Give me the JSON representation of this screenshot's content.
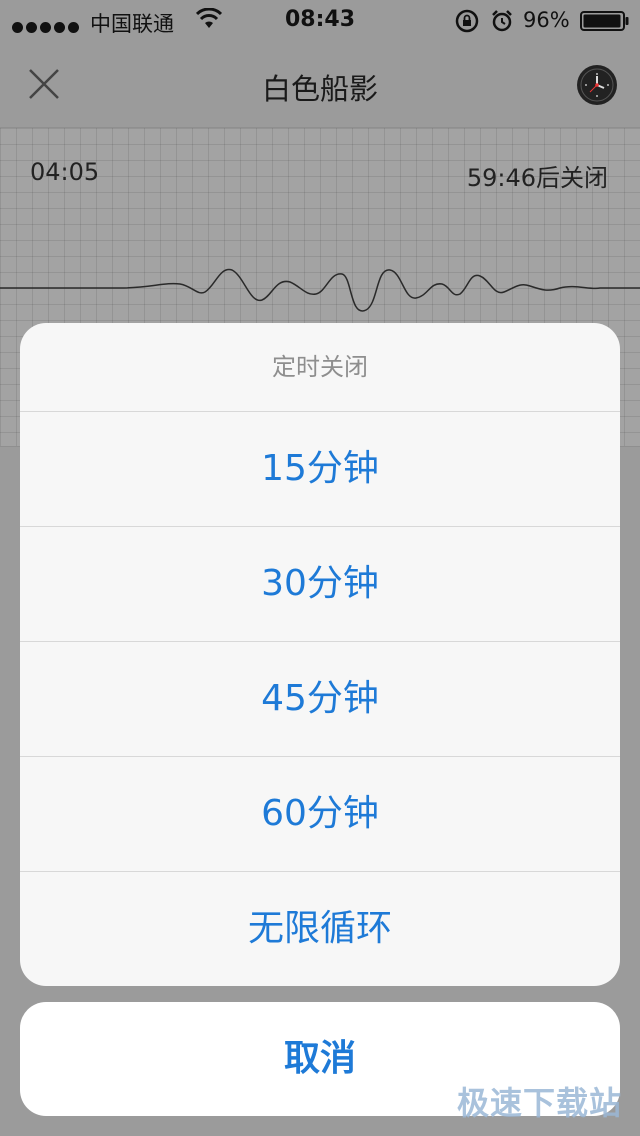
{
  "status_bar": {
    "carrier": "中国联通",
    "time": "08:43",
    "battery": "96%"
  },
  "nav": {
    "title": "白色船影"
  },
  "player": {
    "elapsed": "04:05",
    "remaining": "59:46后关闭"
  },
  "sheet": {
    "title": "定时关闭",
    "options": [
      "15分钟",
      "30分钟",
      "45分钟",
      "60分钟",
      "无限循环"
    ],
    "cancel": "取消"
  },
  "watermark": "极速下载站",
  "colors": {
    "accent": "#1e7ad7",
    "dim_background": "#9b9b9b"
  }
}
